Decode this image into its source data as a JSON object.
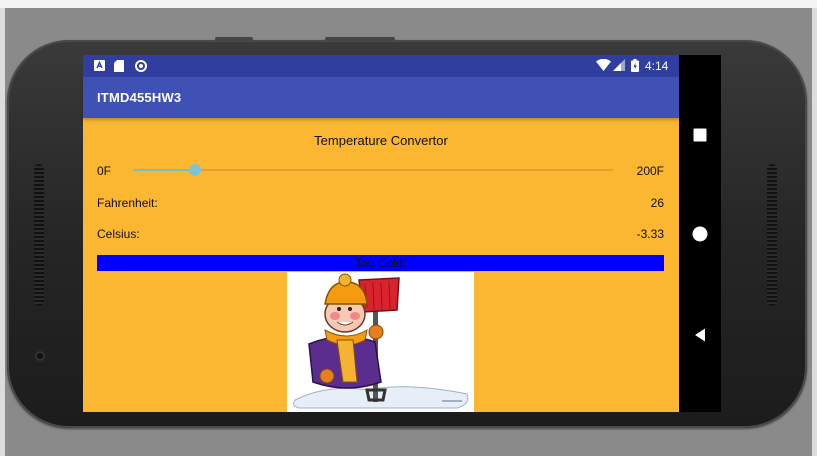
{
  "status_bar": {
    "time": "4:14",
    "left_icons": [
      "android-notification-icon",
      "sd-card-icon",
      "circle-icon"
    ],
    "right_icons": [
      "wifi-icon",
      "signal-icon",
      "battery-icon"
    ]
  },
  "toolbar": {
    "title": "ITMD455HW3"
  },
  "converter": {
    "heading": "Temperature Convertor",
    "slider_min_label": "0F",
    "slider_max_label": "200F",
    "slider_value_fraction": 0.13,
    "fahrenheit_label": "Fahrenheit:",
    "fahrenheit_value": "26",
    "celsius_label": "Celsius:",
    "celsius_value": "-3.33",
    "result_text": "Too Cold!"
  },
  "colors": {
    "statusbar": "#303f9f",
    "toolbar": "#3f51b5",
    "background": "#fbb731",
    "result_bar": "#0000ff",
    "slider_accent": "#7cc6d4"
  },
  "nav_bar": {
    "buttons": [
      "square-recents-icon",
      "circle-home-icon",
      "triangle-back-icon"
    ]
  }
}
